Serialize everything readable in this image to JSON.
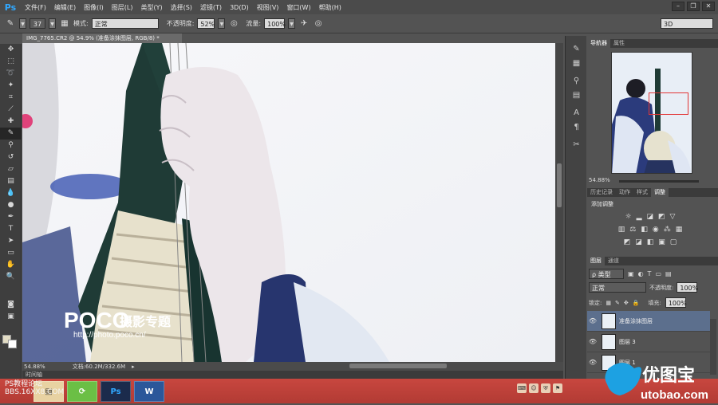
{
  "app": {
    "logo": "Ps"
  },
  "menu": [
    "文件(F)",
    "编辑(E)",
    "图像(I)",
    "图层(L)",
    "类型(Y)",
    "选择(S)",
    "滤镜(T)",
    "3D(D)",
    "视图(V)",
    "窗口(W)",
    "帮助(H)"
  ],
  "window_controls": {
    "minimize": "–",
    "restore": "❐",
    "close": "✕"
  },
  "options": {
    "brush_size": "37",
    "mode_label": "模式:",
    "mode_value": "正常",
    "opacity_label": "不透明度:",
    "opacity_value": "52%",
    "flow_label": "流量:",
    "flow_value": "100%",
    "workspace": "3D"
  },
  "document": {
    "tab_title": "IMG_7765.CR2 @ 54.9% (准备涂抹图层, RGB/8) *",
    "zoom": "54.88%",
    "doc_size": "文档:60.2M/332.6M",
    "timeline_label": "时间轴"
  },
  "watermark": {
    "logo": "POCO",
    "title": "摄影专题",
    "url": "http://photo.poco.cn/"
  },
  "navigator": {
    "tab_active": "导航器",
    "tab_other": "属性",
    "zoom": "54.88%"
  },
  "adjust_tabs": [
    "历史记录",
    "动作",
    "样式",
    "调整"
  ],
  "adjust": {
    "heading": "添加调整"
  },
  "layers": {
    "tabs": [
      "图层",
      "通道"
    ],
    "filter": "ρ 类型",
    "blend": "正常",
    "opacity_label": "不透明度:",
    "opacity": "100%",
    "lock_label": "锁定:",
    "fill_label": "填充:",
    "fill": "100%",
    "items": [
      {
        "name": "准备涂抹图层",
        "selected": true
      },
      {
        "name": "图层 3",
        "selected": false
      },
      {
        "name": "图层 1",
        "selected": false
      }
    ]
  },
  "taskbar": {
    "ps_label": "Ps",
    "word_label": "W"
  },
  "site_watermark_left": {
    "line1": "PS教程论坛",
    "line2": "BBS.16XX8.COM"
  },
  "site_watermark_right": {
    "brand": "优图宝",
    "url": "utobao.com"
  }
}
